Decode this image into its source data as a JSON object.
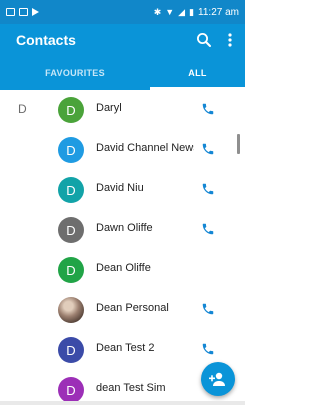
{
  "status_bar": {
    "time": "11:27 am",
    "icons": [
      "mail-icon",
      "image-icon",
      "play-icon",
      "bluetooth-icon",
      "wifi-icon",
      "signal-icon",
      "battery-icon"
    ]
  },
  "app_bar": {
    "title": "Contacts",
    "search_icon": "search-icon",
    "more_icon": "more-vert-icon"
  },
  "tabs": [
    {
      "label": "FAVOURITES",
      "selected": false
    },
    {
      "label": "ALL",
      "selected": true
    }
  ],
  "contacts": [
    {
      "section": "D",
      "initial": "D",
      "name": "Daryl",
      "avatar_color": "#4aa33a",
      "has_call": true
    },
    {
      "section": "",
      "initial": "D",
      "name": "David Channel News",
      "avatar_color": "#1f9be2",
      "has_call": true
    },
    {
      "section": "",
      "initial": "D",
      "name": "David Niu",
      "avatar_color": "#12a3a8",
      "has_call": true
    },
    {
      "section": "",
      "initial": "D",
      "name": "Dawn Oliffe",
      "avatar_color": "#6e6e6e",
      "has_call": true
    },
    {
      "section": "",
      "initial": "D",
      "name": "Dean Oliffe",
      "avatar_color": "#21a447",
      "has_call": false
    },
    {
      "section": "",
      "initial": "",
      "name": "Dean Personal",
      "avatar_color": "photo",
      "has_call": true
    },
    {
      "section": "",
      "initial": "D",
      "name": "Dean Test 2",
      "avatar_color": "#3b4ba8",
      "has_call": true
    },
    {
      "section": "",
      "initial": "D",
      "name": "dean Test Sim",
      "avatar_color": "#9c2fb7",
      "has_call": false
    }
  ],
  "fab": {
    "icon": "add-contact-icon"
  },
  "colors": {
    "primary": "#0a94d8",
    "status_bar": "#1187c9",
    "call_icon": "#1487d4"
  }
}
